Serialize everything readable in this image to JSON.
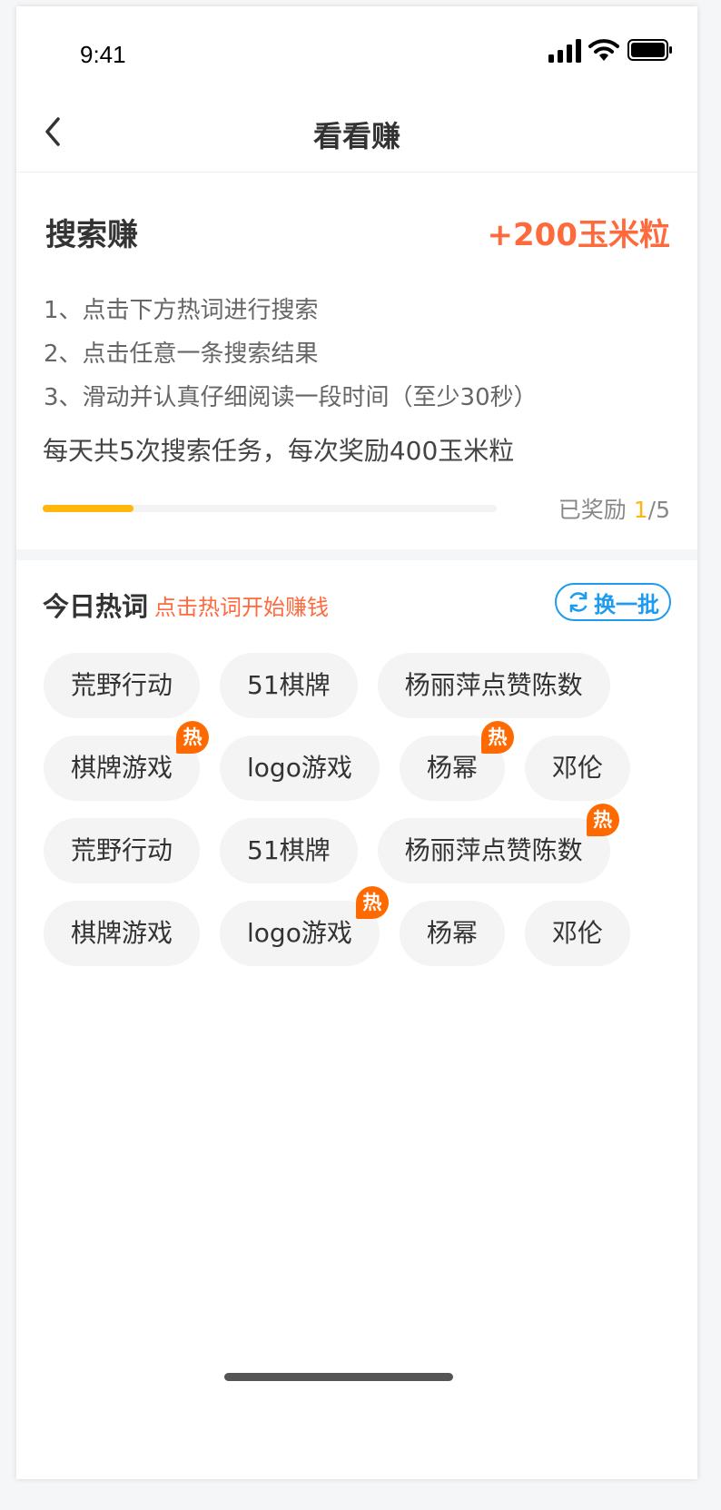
{
  "status_bar": {
    "time": "9:41"
  },
  "nav": {
    "title": "看看赚"
  },
  "task": {
    "title": "搜索赚",
    "reward": "+200玉米粒",
    "steps": [
      "1、点击下方热词进行搜索",
      "2、点击任意一条搜索结果",
      "3、滑动并认真仔细阅读一段时间（至少30秒）"
    ],
    "daily_info": "每天共5次搜索任务，每次奖励400玉米粒",
    "progress": {
      "label": "已奖励",
      "done": "1",
      "total_text": "/5",
      "fraction": 0.2
    }
  },
  "hot_words": {
    "title": "今日热词",
    "hint": "点击热词开始赚钱",
    "refresh_label": "换一批",
    "badge_label": "热",
    "rows": [
      [
        {
          "label": "荒野行动",
          "hot": false
        },
        {
          "label": "51棋牌",
          "hot": false
        },
        {
          "label": "杨丽萍点赞陈数",
          "hot": false
        }
      ],
      [
        {
          "label": "棋牌游戏",
          "hot": true
        },
        {
          "label": "logo游戏",
          "hot": false
        },
        {
          "label": "杨幂",
          "hot": true
        },
        {
          "label": "邓伦",
          "hot": false
        }
      ],
      [
        {
          "label": "荒野行动",
          "hot": false
        },
        {
          "label": "51棋牌",
          "hot": false
        },
        {
          "label": "杨丽萍点赞陈数",
          "hot": true
        }
      ],
      [
        {
          "label": "棋牌游戏",
          "hot": false
        },
        {
          "label": "logo游戏",
          "hot": true
        },
        {
          "label": "杨幂",
          "hot": false
        },
        {
          "label": "邓伦",
          "hot": false
        }
      ]
    ]
  },
  "colors": {
    "accent": "#ff6a3d",
    "progress": "#ffb70d",
    "link_blue": "#1e9bef",
    "hot_badge": "#ff6a00"
  },
  "icons": [
    "signal-icon",
    "wifi-icon",
    "battery-icon",
    "back-icon",
    "refresh-icon"
  ]
}
